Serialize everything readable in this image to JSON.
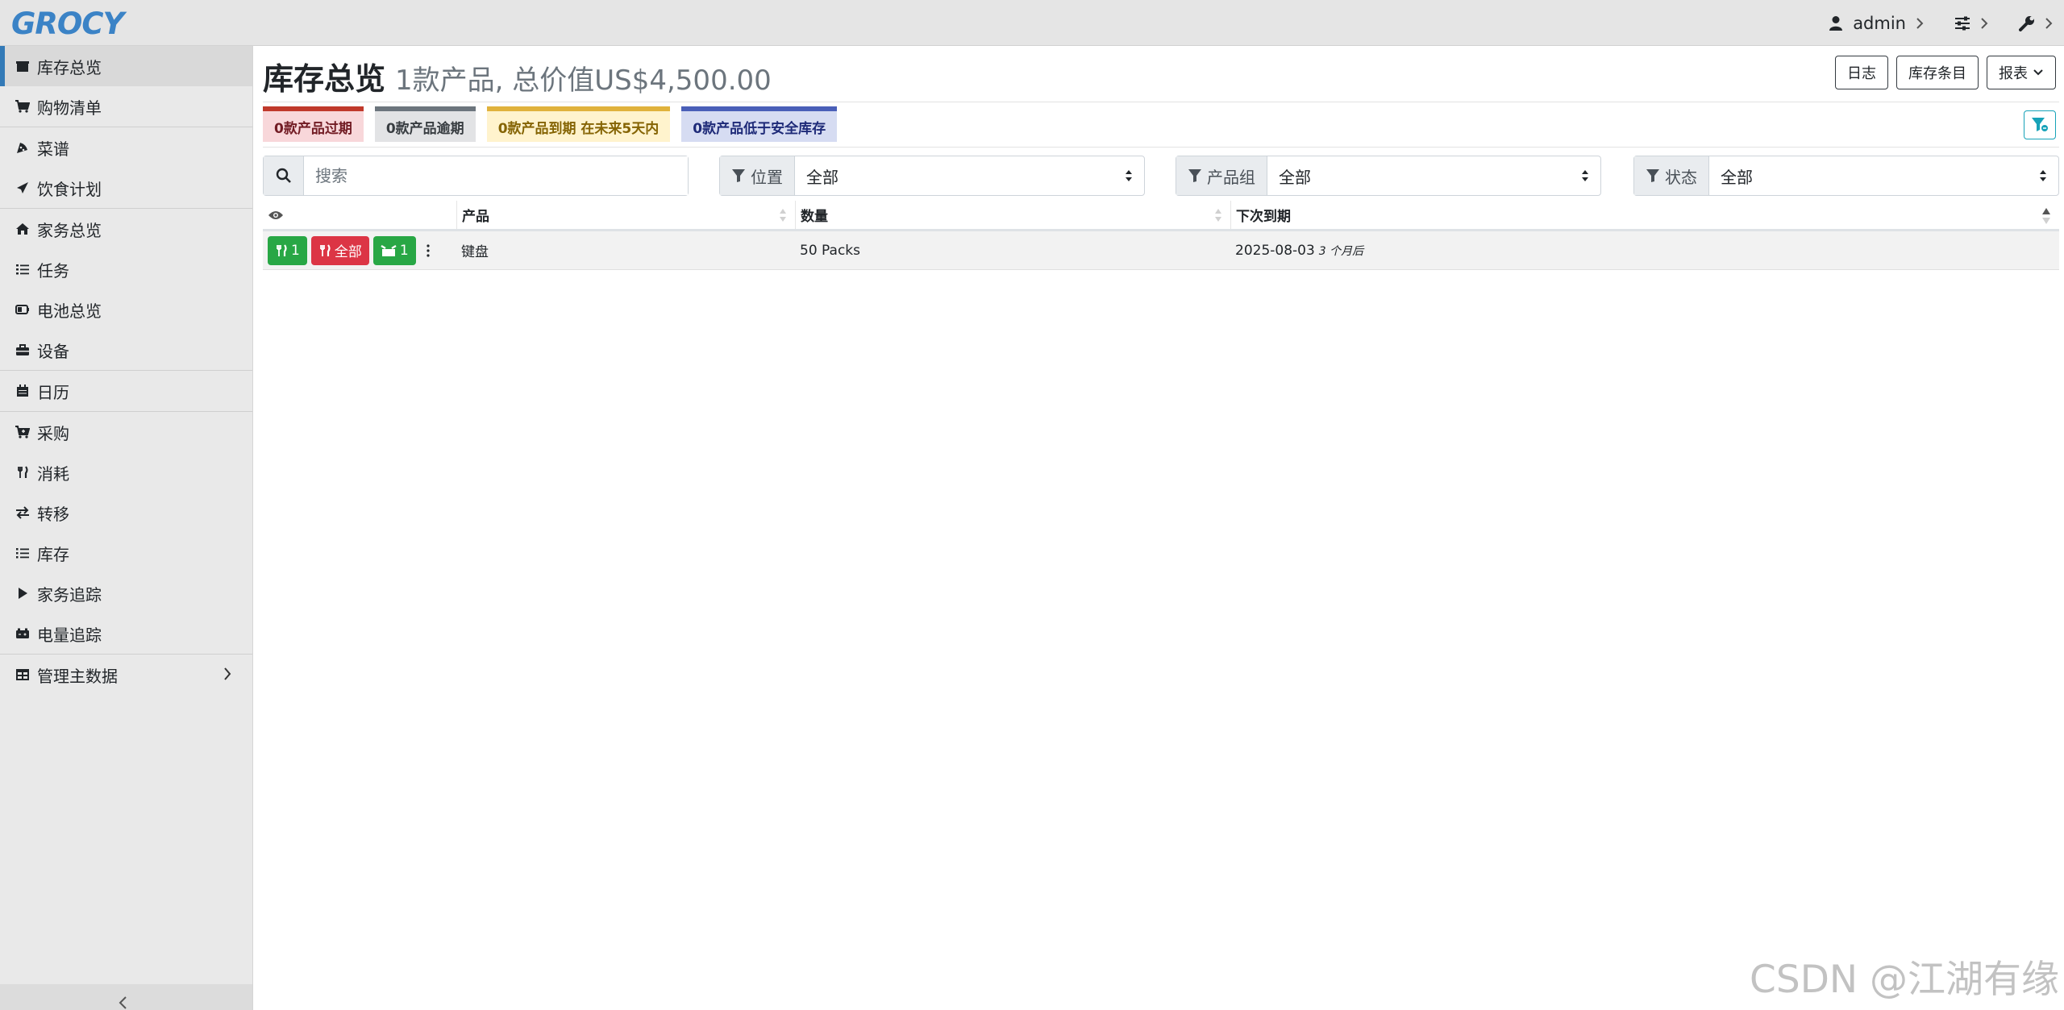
{
  "app": {
    "logo_text": "GROCY"
  },
  "header": {
    "user": "admin",
    "icons": [
      "user-icon",
      "sliders-icon",
      "wrench-icon"
    ]
  },
  "sidebar": {
    "items": [
      {
        "label": "库存总览",
        "icon": "box-icon"
      },
      {
        "label": "购物清单",
        "icon": "cart-icon"
      },
      {
        "label": "菜谱",
        "icon": "pizza-icon"
      },
      {
        "label": "饮食计划",
        "icon": "paper-plane-icon"
      },
      {
        "label": "家务总览",
        "icon": "home-icon"
      },
      {
        "label": "任务",
        "icon": "tasks-icon"
      },
      {
        "label": "电池总览",
        "icon": "battery-icon"
      },
      {
        "label": "设备",
        "icon": "toolbox-icon"
      },
      {
        "label": "日历",
        "icon": "calendar-icon"
      },
      {
        "label": "采购",
        "icon": "cart-plus-icon"
      },
      {
        "label": "消耗",
        "icon": "utensils-icon"
      },
      {
        "label": "转移",
        "icon": "exchange-icon"
      },
      {
        "label": "库存",
        "icon": "list-icon"
      },
      {
        "label": "家务追踪",
        "icon": "play-icon"
      },
      {
        "label": "电量追踪",
        "icon": "car-battery-icon"
      },
      {
        "label": "管理主数据",
        "icon": "table-icon"
      }
    ]
  },
  "page": {
    "title": "库存总览",
    "subtitle": "1款产品, 总价值US$4,500.00",
    "buttons": {
      "journal": "日志",
      "entries": "库存条目",
      "reports": "报表"
    }
  },
  "badges": {
    "expired": "0款产品过期",
    "overdue": "0款产品逾期",
    "due_soon": "0款产品到期 在未来5天内",
    "below_min": "0款产品低于安全库存"
  },
  "filters": {
    "search_placeholder": "搜索",
    "location_label": "位置",
    "location_value": "全部",
    "group_label": "产品组",
    "group_value": "全部",
    "status_label": "状态",
    "status_value": "全部"
  },
  "table": {
    "headers": {
      "product": "产品",
      "amount": "数量",
      "next_due": "下次到期"
    },
    "rows": [
      {
        "consume_one": "1",
        "consume_all": "全部",
        "open_one": "1",
        "product": "键盘",
        "amount": "50 Packs",
        "due_date": "2025-08-03",
        "due_relative": "3 个月后"
      }
    ]
  },
  "colors": {
    "accent": "#337ab7",
    "success": "#28a745",
    "danger": "#dc3545",
    "info": "#17a2b8"
  },
  "watermark": "CSDN @江湖有缘"
}
